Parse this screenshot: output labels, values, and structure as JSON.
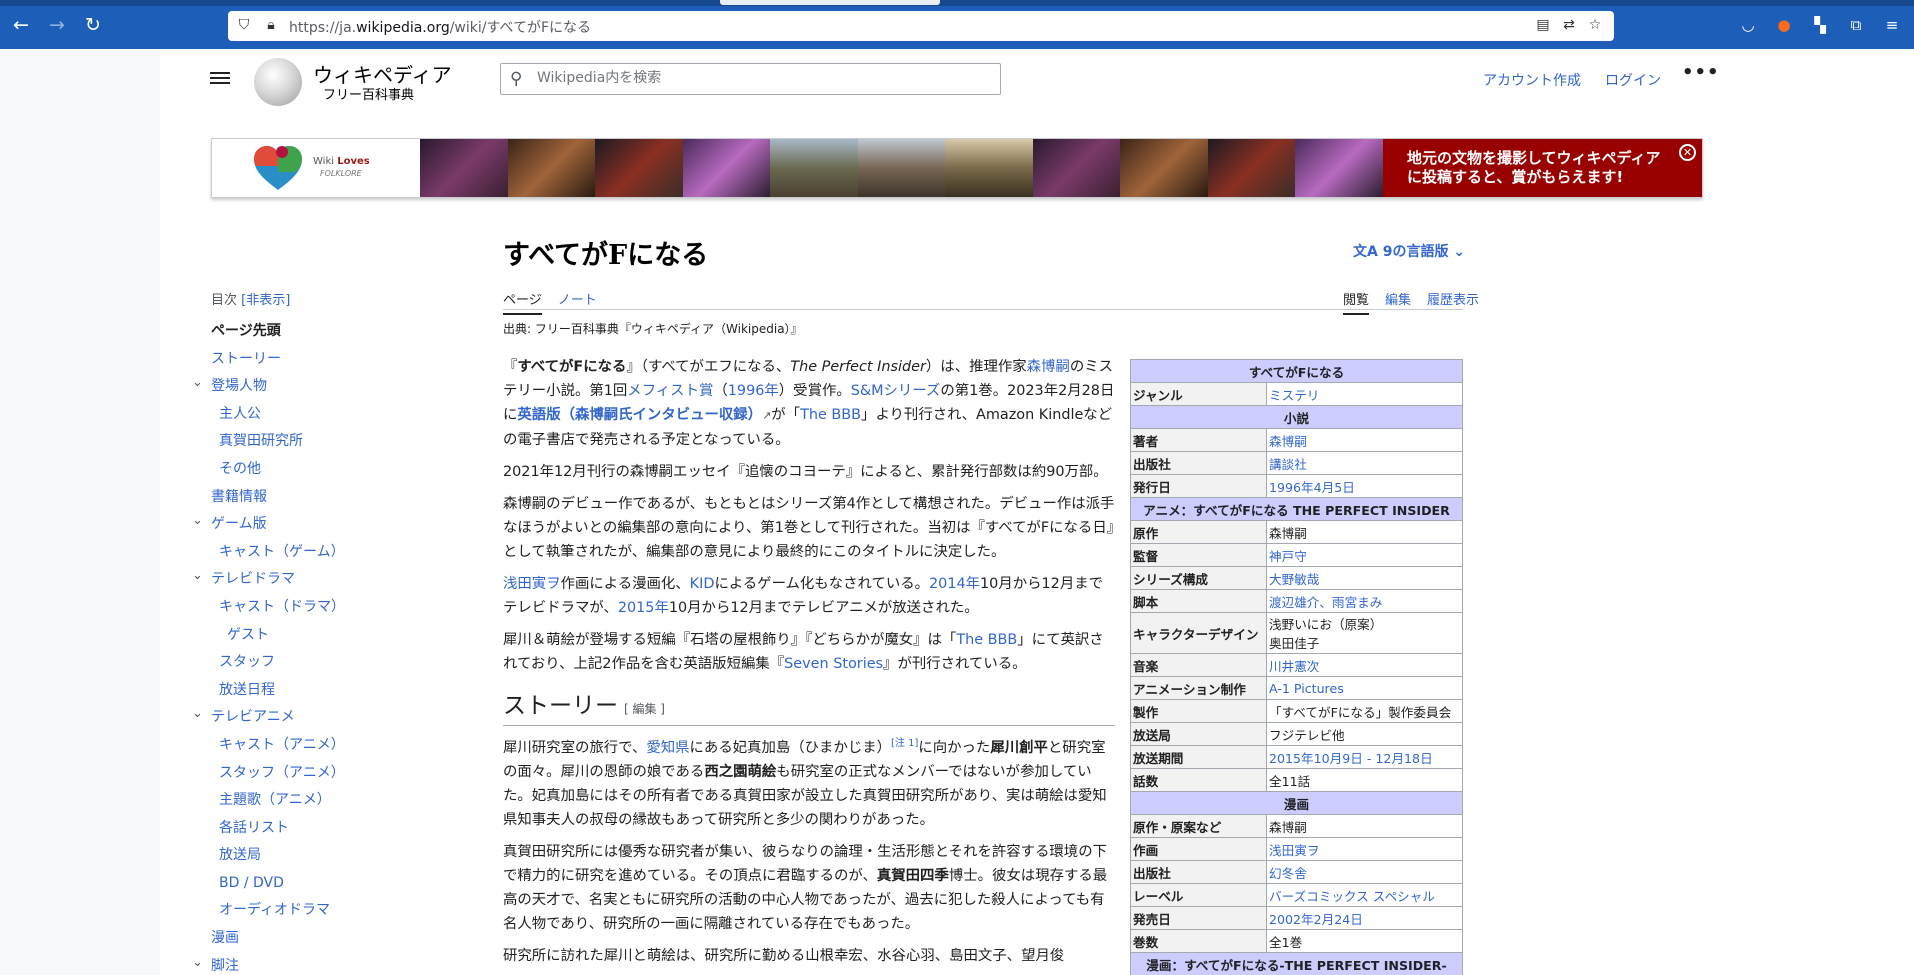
{
  "browser": {
    "url_prefix": "https://ja.",
    "url_domain": "wikipedia.org",
    "url_path": "/wiki/すべてがFになる"
  },
  "header": {
    "site_title": "ウィキペディア",
    "site_subtitle": "フリー百科事典",
    "search_placeholder": "Wikipedia内を検索",
    "create_account": "アカウント作成",
    "login": "ログイン"
  },
  "banner": {
    "wlf_wiki": "Wiki ",
    "wlf_loves": "Loves",
    "wlf_folklore": "FOLKLORE",
    "cta_line1": "地元の文物を撮影してウィキペディア",
    "cta_line2": "に投稿すると、賞がもらえます!",
    "accent": "#990000"
  },
  "toc": {
    "label": "目次",
    "hide": "[非表示]",
    "items": [
      {
        "label": "ページ先頭",
        "indent": 0,
        "active": true
      },
      {
        "label": "ストーリー",
        "indent": 0
      },
      {
        "label": "登場人物",
        "indent": 0,
        "chevron": true
      },
      {
        "label": "主人公",
        "indent": 1
      },
      {
        "label": "真賀田研究所",
        "indent": 1
      },
      {
        "label": "その他",
        "indent": 1
      },
      {
        "label": "書籍情報",
        "indent": 0
      },
      {
        "label": "ゲーム版",
        "indent": 0,
        "chevron": true
      },
      {
        "label": "キャスト（ゲーム）",
        "indent": 1
      },
      {
        "label": "テレビドラマ",
        "indent": 0,
        "chevron": true
      },
      {
        "label": "キャスト（ドラマ）",
        "indent": 1
      },
      {
        "label": "ゲスト",
        "indent": 2
      },
      {
        "label": "スタッフ",
        "indent": 1
      },
      {
        "label": "放送日程",
        "indent": 1
      },
      {
        "label": "テレビアニメ",
        "indent": 0,
        "chevron": true
      },
      {
        "label": "キャスト（アニメ）",
        "indent": 1
      },
      {
        "label": "スタッフ（アニメ）",
        "indent": 1
      },
      {
        "label": "主題歌（アニメ）",
        "indent": 1
      },
      {
        "label": "各話リスト",
        "indent": 1
      },
      {
        "label": "放送局",
        "indent": 1
      },
      {
        "label": "BD / DVD",
        "indent": 1
      },
      {
        "label": "オーディオドラマ",
        "indent": 1
      },
      {
        "label": "漫画",
        "indent": 0
      },
      {
        "label": "脚注",
        "indent": 0,
        "chevron": true
      }
    ]
  },
  "article": {
    "title": "すべてがFになる",
    "languages": "9の言語版",
    "tab_page": "ページ",
    "tab_talk": "ノート",
    "tab_read": "閲覧",
    "tab_edit": "編集",
    "tab_history": "履歴表示",
    "source_line": "出典: フリー百科事典『ウィキペディア（Wikipedia）』",
    "section_story": "ストーリー",
    "edit_link": "[ 編集 ]"
  },
  "infobox": {
    "rows": [
      {
        "type": "caption",
        "text": "すべてがFになる"
      },
      {
        "label": "ジャンル",
        "value": "ミステリ",
        "link": true
      },
      {
        "type": "caption",
        "text": "小説"
      },
      {
        "label": "著者",
        "value": "森博嗣",
        "link": true
      },
      {
        "label": "出版社",
        "value": "講談社",
        "link": true
      },
      {
        "label": "発行日",
        "value": "1996年4月5日",
        "link": true
      },
      {
        "type": "caption",
        "text": "アニメ：すべてがFになる THE PERFECT INSIDER"
      },
      {
        "label": "原作",
        "value": "森博嗣"
      },
      {
        "label": "監督",
        "value": "神戸守",
        "link": true
      },
      {
        "label": "シリーズ構成",
        "value": "大野敏哉",
        "link": true
      },
      {
        "label": "脚本",
        "value": "渡辺雄介、雨宮まみ",
        "link": true
      },
      {
        "label": "キャラクターデザイン",
        "value": "浅野いにお（原案）\n奥田佳子",
        "tall": true
      },
      {
        "label": "音楽",
        "value": "川井憲次",
        "link": true
      },
      {
        "label": "アニメーション制作",
        "value": "A-1 Pictures",
        "link": true
      },
      {
        "label": "製作",
        "value": "「すべてがFになる」製作委員会"
      },
      {
        "label": "放送局",
        "value": "フジテレビ他"
      },
      {
        "label": "放送期間",
        "value": "2015年10月9日 - 12月18日",
        "link": true
      },
      {
        "label": "話数",
        "value": "全11話"
      },
      {
        "type": "caption",
        "text": "漫画"
      },
      {
        "label": "原作・原案など",
        "value": "森博嗣"
      },
      {
        "label": "作画",
        "value": "浅田寅ヲ",
        "link": true
      },
      {
        "label": "出版社",
        "value": "幻冬舎",
        "link": true
      },
      {
        "label": "レーベル",
        "value": "バーズコミックス スペシャル",
        "link": true
      },
      {
        "label": "発売日",
        "value": "2002年2月24日",
        "link": true
      },
      {
        "label": "巻数",
        "value": "全1巻"
      },
      {
        "type": "caption",
        "text": "漫画：すべてがFになる-THE PERFECT INSIDER-"
      }
    ]
  }
}
